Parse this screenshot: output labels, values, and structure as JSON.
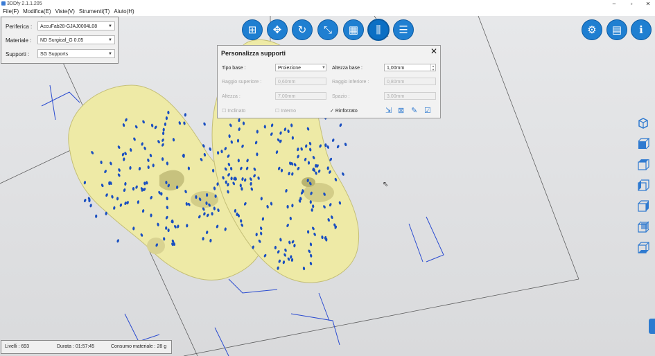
{
  "window": {
    "title": "3DDfy 2.1.1.205",
    "min": "–",
    "restore": "▫",
    "close": "✕"
  },
  "menu": [
    "File(F)",
    "Modifica(E)",
    "Viste(V)",
    "Strumenti(T)",
    "Aiuto(H)"
  ],
  "device_panel": {
    "device_label": "Periferica :",
    "device_value": "AccuFab28-GJAJ0004L08",
    "material_label": "Materiale :",
    "material_value": "ND Surgical_G 0.05",
    "supports_label": "Supporti :",
    "supports_value": "SG Supports"
  },
  "toolbar": {
    "icons": [
      "add-file-icon",
      "move-icon",
      "rotate-icon",
      "scale-icon",
      "layout-icon",
      "supports-icon",
      "slice-icon"
    ],
    "right_icons": [
      "settings-icon",
      "list-icon",
      "info-icon"
    ]
  },
  "dialog": {
    "title": "Personalizza supporti",
    "base_type_label": "Tipo base :",
    "base_type_value": "Proiezione",
    "base_height_label": "Altezza base :",
    "base_height_value": "1,00mm",
    "top_radius_label": "Raggio superiore :",
    "top_radius_value": "0,60mm",
    "bottom_radius_label": "Raggio inferiore :",
    "bottom_radius_value": "0,80mm",
    "height_label": "Altezza :",
    "height_value": "7,00mm",
    "spacing_label": "Spazio :",
    "spacing_value": "3,00mm",
    "check1_label": "Inclinato",
    "check2_label": "Interno",
    "reinforced_label": "Rinforzato",
    "reinforced_mark": "✓"
  },
  "status": {
    "layers": "Livelli :  693",
    "duration": "Durata :  01:57:45",
    "material": "Consumo materiale :  28 g"
  },
  "colors": {
    "accent": "#1f7fd1",
    "model": "#eeeaa6",
    "support_point": "#1a4fc0",
    "box_edge": "#2a4bd0"
  }
}
